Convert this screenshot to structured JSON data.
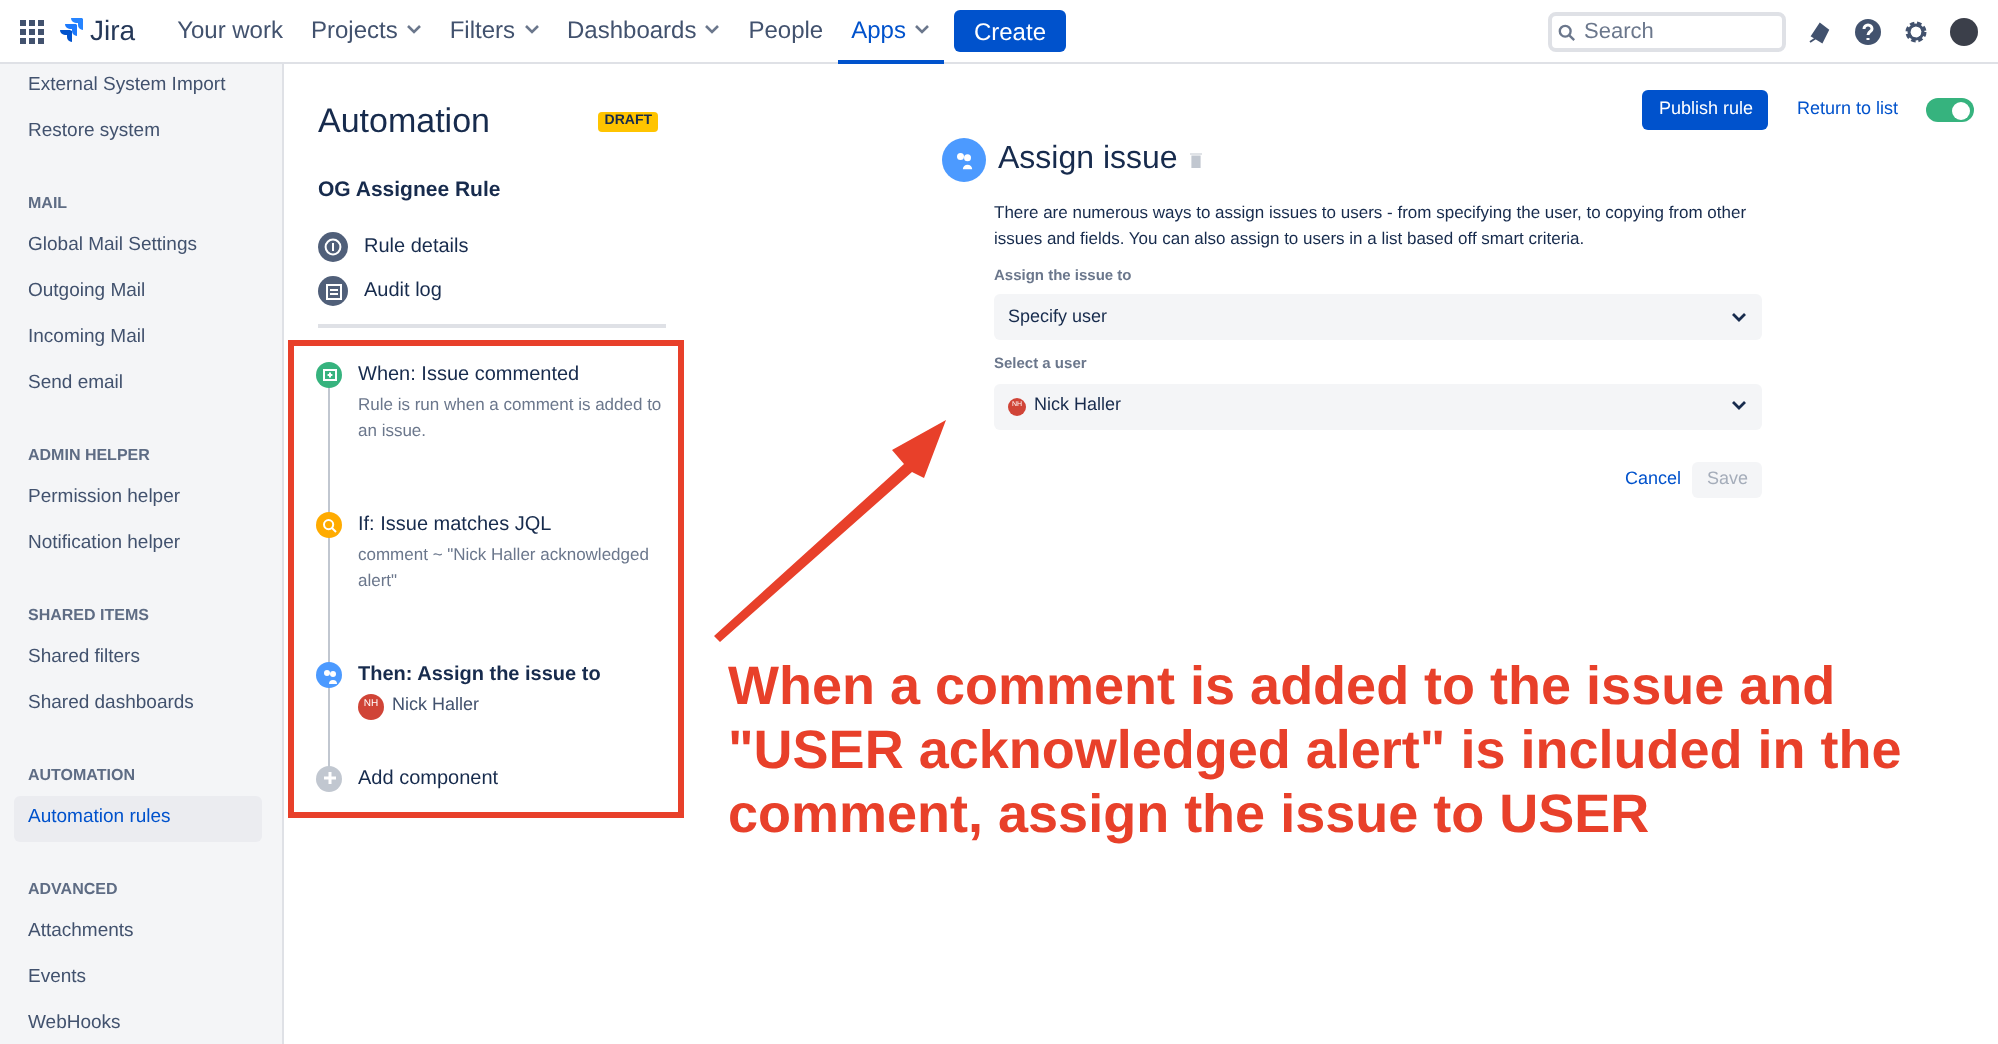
{
  "topnav": {
    "product": "Jira",
    "items": [
      {
        "label": "Your work",
        "dropdown": false,
        "selected": false
      },
      {
        "label": "Projects",
        "dropdown": true,
        "selected": false
      },
      {
        "label": "Filters",
        "dropdown": true,
        "selected": false
      },
      {
        "label": "Dashboards",
        "dropdown": true,
        "selected": false
      },
      {
        "label": "People",
        "dropdown": false,
        "selected": false
      },
      {
        "label": "Apps",
        "dropdown": true,
        "selected": true
      }
    ],
    "create": "Create",
    "search": {
      "placeholder": "Search"
    }
  },
  "sidebar": {
    "sections": [
      {
        "items": [
          {
            "label": "External System Import",
            "selected": false
          },
          {
            "label": "Restore system",
            "selected": false
          }
        ]
      },
      {
        "heading": "MAIL",
        "items": [
          {
            "label": "Global Mail Settings",
            "selected": false
          },
          {
            "label": "Outgoing Mail",
            "selected": false
          },
          {
            "label": "Incoming Mail",
            "selected": false
          },
          {
            "label": "Send email",
            "selected": false
          }
        ]
      },
      {
        "heading": "ADMIN HELPER",
        "items": [
          {
            "label": "Permission helper",
            "selected": false
          },
          {
            "label": "Notification helper",
            "selected": false
          }
        ]
      },
      {
        "heading": "SHARED ITEMS",
        "items": [
          {
            "label": "Shared filters",
            "selected": false
          },
          {
            "label": "Shared dashboards",
            "selected": false
          }
        ]
      },
      {
        "heading": "AUTOMATION",
        "items": [
          {
            "label": "Automation rules",
            "selected": true
          }
        ]
      },
      {
        "heading": "ADVANCED",
        "items": [
          {
            "label": "Attachments",
            "selected": false
          },
          {
            "label": "Events",
            "selected": false
          },
          {
            "label": "WebHooks",
            "selected": false
          }
        ]
      }
    ]
  },
  "rule": {
    "title": "Automation",
    "badge": "DRAFT",
    "name": "OG Assignee Rule",
    "links": [
      {
        "kind": "details",
        "label": "Rule details"
      },
      {
        "kind": "audit",
        "label": "Audit log"
      }
    ],
    "steps": [
      {
        "kind": "trigger",
        "title": "When: Issue commented",
        "detail": "Rule is run when a comment is added to an issue."
      },
      {
        "kind": "condition",
        "title": "If: Issue matches JQL",
        "detail": "comment ~ \"Nick Haller acknowledged alert\""
      },
      {
        "kind": "action",
        "title": "Then: Assign the issue to",
        "assignee": {
          "initials": "NH",
          "name": "Nick Haller"
        }
      },
      {
        "kind": "add",
        "title": "Add component"
      }
    ]
  },
  "toolbar": {
    "publish": "Publish rule",
    "return": "Return to list",
    "enabled": true
  },
  "editor": {
    "title": "Assign issue",
    "description": "There are numerous ways to assign issues to users - from specifying the user, to copying from other issues and fields. You can also assign to users in a list based off smart criteria.",
    "fields": [
      {
        "label": "Assign the issue to",
        "value": "Specify user"
      },
      {
        "label": "Select a user",
        "value": "Nick Haller",
        "avatar": "NH"
      }
    ],
    "cancel": "Cancel",
    "save": "Save",
    "save_disabled": true
  },
  "annotation": {
    "text": "When a comment is added to the issue and \"USER acknowledged alert\" is included in the comment, assign the issue to USER"
  }
}
